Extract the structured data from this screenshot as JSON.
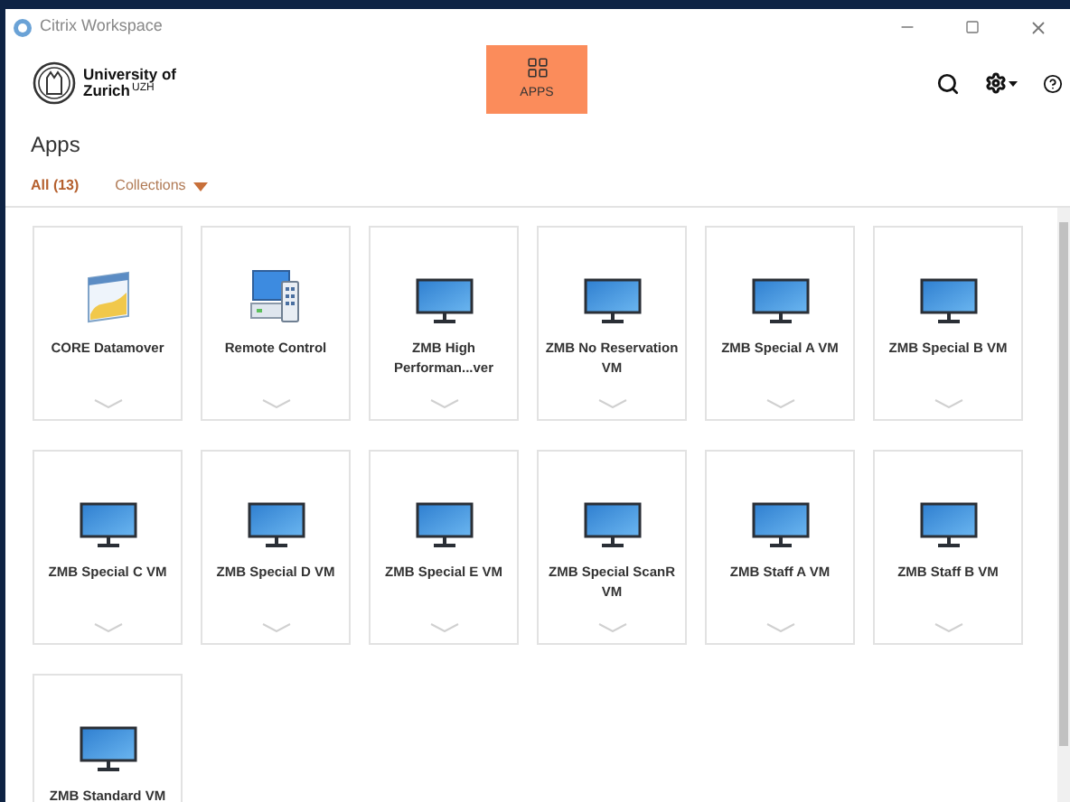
{
  "window": {
    "title": "Citrix Workspace"
  },
  "logo": {
    "line_1": "University of",
    "line_2": "Zurich",
    "mark": "UZH"
  },
  "nav": [
    {
      "label": "APPS",
      "selected": true
    }
  ],
  "page_title": "Apps",
  "tabs": [
    {
      "label": "All (13)",
      "selected": true,
      "kind": "plain"
    },
    {
      "label": "Collections",
      "selected": false,
      "kind": "dropdown"
    }
  ],
  "apps": [
    {
      "name": "CORE Datamover",
      "kind": "datamover"
    },
    {
      "name": "Remote Control",
      "kind": "remote"
    },
    {
      "name": "ZMB High Performan...ver",
      "kind": "monitor"
    },
    {
      "name": "ZMB No Reservation VM",
      "kind": "monitor"
    },
    {
      "name": "ZMB Special A VM",
      "kind": "monitor"
    },
    {
      "name": "ZMB Special B VM",
      "kind": "monitor"
    },
    {
      "name": "ZMB Special C VM",
      "kind": "monitor"
    },
    {
      "name": "ZMB Special D VM",
      "kind": "monitor"
    },
    {
      "name": "ZMB Special E VM",
      "kind": "monitor"
    },
    {
      "name": "ZMB Special ScanR VM",
      "kind": "monitor"
    },
    {
      "name": "ZMB Staff A VM",
      "kind": "monitor"
    },
    {
      "name": "ZMB Staff B VM",
      "kind": "monitor"
    },
    {
      "name": "ZMB Standard VM",
      "kind": "monitor"
    }
  ]
}
